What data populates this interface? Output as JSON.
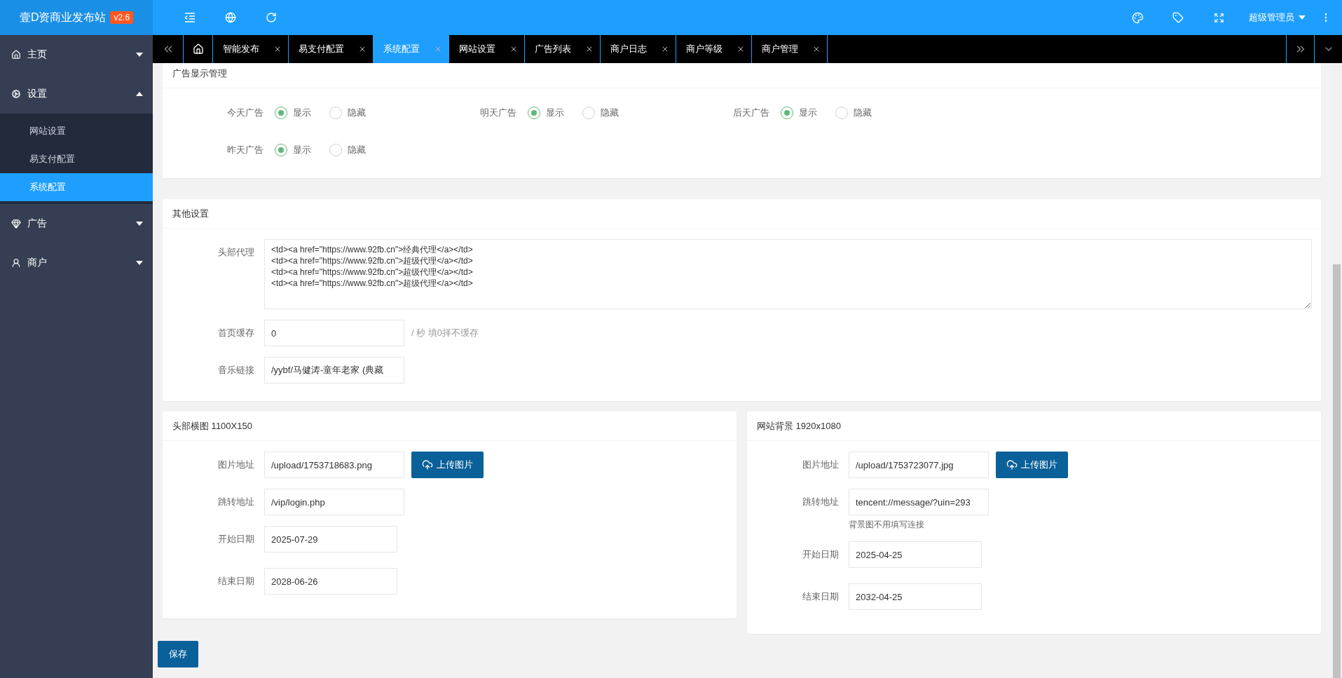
{
  "app": {
    "title": "壹D资商业发布站",
    "version": "v2.6"
  },
  "toolbar": {
    "user": "超级管理员"
  },
  "sidebar": {
    "items": [
      {
        "label": "主页",
        "expanded": false
      },
      {
        "label": "设置",
        "expanded": true,
        "children": [
          {
            "label": "网站设置",
            "selected": false
          },
          {
            "label": "易支付配置",
            "selected": false
          },
          {
            "label": "系统配置",
            "selected": true
          }
        ]
      },
      {
        "label": "广告",
        "expanded": false
      },
      {
        "label": "商户",
        "expanded": false
      }
    ]
  },
  "tabs": [
    {
      "label": "智能发布",
      "selected": false
    },
    {
      "label": "易支付配置",
      "selected": false
    },
    {
      "label": "系统配置",
      "selected": true
    },
    {
      "label": "网站设置",
      "selected": false
    },
    {
      "label": "广告列表",
      "selected": false
    },
    {
      "label": "商户日志",
      "selected": false
    },
    {
      "label": "商户等级",
      "selected": false
    },
    {
      "label": "商户管理",
      "selected": false
    }
  ],
  "ad_display": {
    "title": "广告显示管理",
    "options": [
      {
        "label": "今天广告",
        "choices": [
          {
            "label": "显示",
            "selected": true
          },
          {
            "label": "隐藏",
            "selected": false
          }
        ]
      },
      {
        "label": "明天广告",
        "choices": [
          {
            "label": "显示",
            "selected": true
          },
          {
            "label": "隐藏",
            "selected": false
          }
        ]
      },
      {
        "label": "后天广告",
        "choices": [
          {
            "label": "显示",
            "selected": true
          },
          {
            "label": "隐藏",
            "selected": false
          }
        ]
      },
      {
        "label": "昨天广告",
        "choices": [
          {
            "label": "显示",
            "selected": true
          },
          {
            "label": "隐藏",
            "selected": false
          }
        ]
      }
    ]
  },
  "other_settings": {
    "title": "其他设置",
    "fields": [
      {
        "label": "头部代理",
        "kind": "textarea",
        "value": "<td><a href=\"https://www.92fb.cn\">经典代理</a></td>\n<td><a href=\"https://www.92fb.cn\">超级代理</a></td>\n<td><a href=\"https://www.92fb.cn\">超级代理</a></td>\n<td><a href=\"https://www.92fb.cn\">超级代理</a></td>"
      },
      {
        "label": "首页缓存",
        "kind": "input",
        "value": "0",
        "hint": "/ 秒 填0择不缓存"
      },
      {
        "label": "音乐链接",
        "kind": "input",
        "value": "/yybf/马健涛-童年老家 (典藏"
      }
    ]
  },
  "image_cards": [
    {
      "title": "头部横图 1100X150",
      "fields": [
        {
          "label": "图片地址",
          "kind": "upload",
          "value": "/upload/1753718683.png",
          "button": "上传图片"
        },
        {
          "label": "跳转地址",
          "kind": "input",
          "value": "/vip/login.php"
        },
        {
          "label": "开始日期",
          "kind": "date",
          "value": "2025-07-29"
        },
        {
          "label": "结束日期",
          "kind": "date",
          "value": "2028-06-26"
        }
      ]
    },
    {
      "title": "网站背景 1920x1080",
      "fields": [
        {
          "label": "图片地址",
          "kind": "upload",
          "value": "/upload/1753723077.jpg",
          "button": "上传图片"
        },
        {
          "label": "跳转地址",
          "kind": "input",
          "value": "tencent://message/?uin=293",
          "note": "背景图不用填写连接"
        },
        {
          "label": "开始日期",
          "kind": "date",
          "value": "2025-04-25"
        },
        {
          "label": "结束日期",
          "kind": "date",
          "value": "2032-04-25"
        }
      ]
    }
  ],
  "save_button": "保存"
}
